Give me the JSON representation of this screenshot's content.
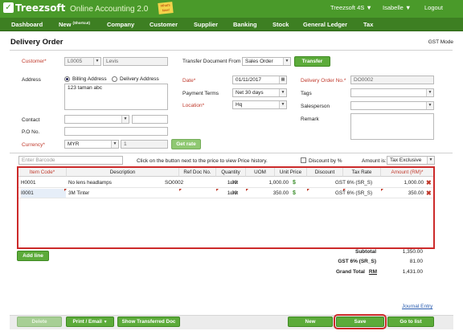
{
  "brand": {
    "logo": "Treezsoft",
    "tagline": "Online Accounting 2.0",
    "sticky": "What's New!"
  },
  "top_right": {
    "company": "Treezsoft 4S",
    "user": "Isabelle",
    "logout": "Logout",
    "caret": "▼"
  },
  "nav": [
    {
      "label": "Dashboard"
    },
    {
      "label": "New",
      "sup": "(Shortcut)"
    },
    {
      "label": "Company"
    },
    {
      "label": "Customer"
    },
    {
      "label": "Supplier"
    },
    {
      "label": "Banking"
    },
    {
      "label": "Stock"
    },
    {
      "label": "General Ledger"
    },
    {
      "label": "Tax"
    }
  ],
  "page": {
    "title": "Delivery Order",
    "gst_mode": "GST Mode"
  },
  "form": {
    "customer_label": "Customer*",
    "customer_code": "L0005",
    "customer_name": "Levis",
    "transfer_doc_label": "Transfer Document From",
    "transfer_doc_value": "Sales Order",
    "transfer_button": "Transfer",
    "address_label": "Address",
    "billing_address": "Billing Address",
    "delivery_address": "Delivery Address",
    "address_text": "123 taman abc",
    "date_label": "Date*",
    "date_value": "01/11/2017",
    "payment_terms_label": "Payment Terms",
    "payment_terms_value": "Net 30 days",
    "location_label": "Location*",
    "location_value": "Hq",
    "do_no_label": "Delivery Order No.*",
    "do_no_value": "DO0002",
    "tags_label": "Tags",
    "salesperson_label": "Salesperson",
    "remark_label": "Remark",
    "contact_label": "Contact",
    "po_label": "P.O No.",
    "currency_label": "Currency*",
    "currency_value": "MYR",
    "rate_value": "1",
    "get_rate": "Get rate",
    "barcode_placeholder": "Enter Barcode",
    "price_hint": "Click on the button next to the price to view Price history.",
    "discount_by": "Discount by %",
    "amount_is_label": "Amount is:",
    "amount_is_value": "Tax Exclusive"
  },
  "grid": {
    "headers": [
      "Item Code*",
      "Description",
      "Ref Doc No.",
      "Quantity",
      "UOM",
      "Unit Price",
      "Discount",
      "Tax Rate",
      "Amount (RM)*"
    ],
    "rows": [
      {
        "code": "H0001",
        "desc": "No lens headlamps",
        "ref": "SO0002",
        "qty": "1.00",
        "uom": "unit",
        "price": "1,000.00",
        "disc": "",
        "tax": "GST 6% (SR_S)",
        "amount": "1,000.00"
      },
      {
        "code": "I0001",
        "desc": "3M Tinter",
        "ref": "",
        "qty": "1.00",
        "uom": "unit",
        "price": "350.00",
        "disc": "",
        "tax": "GST 6% (SR_S)",
        "amount": "350.00"
      }
    ]
  },
  "add_line": "Add line",
  "totals": {
    "subtotal_label": "Subtotal",
    "subtotal": "1,350.00",
    "gst_label": "GST 6% (SR_S)",
    "gst": "81.00",
    "grand_label": "Grand Total",
    "currency": "RM",
    "grand": "1,431.00"
  },
  "journal_entry": "Journal Entry",
  "footer": {
    "delete": "Delete",
    "print": "Print / Email",
    "show_transferred": "Show Transferred Doc",
    "new": "New",
    "save": "Save",
    "go_to_list": "Go to list",
    "caret": "▼"
  },
  "colors": {
    "brand_green": "#4a9a2a",
    "nav_green": "#3d7f22",
    "highlight_red": "#cc2a2a"
  }
}
